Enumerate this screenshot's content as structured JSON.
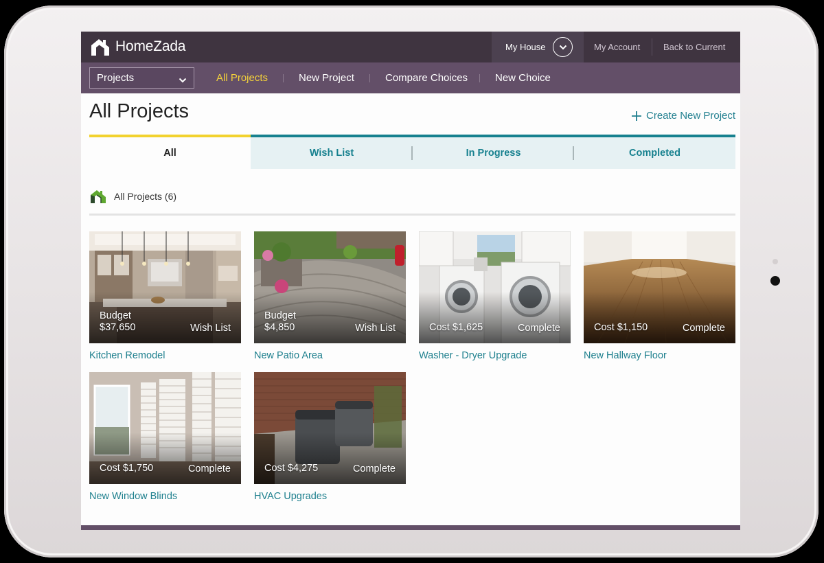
{
  "brand": {
    "name": "HomeZada"
  },
  "topbar": {
    "house_selector": "My House",
    "my_account": "My Account",
    "back_to_current": "Back to Current"
  },
  "subnav": {
    "select_value": "Projects",
    "items": [
      {
        "label": "All Projects",
        "active": true
      },
      {
        "label": "New Project",
        "active": false
      },
      {
        "label": "Compare Choices",
        "active": false
      },
      {
        "label": "New Choice",
        "active": false
      }
    ]
  },
  "page": {
    "title": "All Projects",
    "create_link": "Create New Project"
  },
  "tabs": [
    {
      "label": "All",
      "active": true
    },
    {
      "label": "Wish List",
      "active": false
    },
    {
      "label": "In Progress",
      "active": false
    },
    {
      "label": "Completed",
      "active": false
    }
  ],
  "section": {
    "label": "All Projects (6)"
  },
  "projects": [
    {
      "name": "Kitchen Remodel",
      "amount_label": "Budget",
      "amount": "$37,650",
      "status": "Wish List"
    },
    {
      "name": "New Patio Area",
      "amount_label": "Budget",
      "amount": "$4,850",
      "status": "Wish List"
    },
    {
      "name": "Washer - Dryer Upgrade",
      "amount_text": "Cost $1,625",
      "status": "Complete"
    },
    {
      "name": "New Hallway Floor",
      "amount_text": "Cost $1,150",
      "status": "Complete"
    },
    {
      "name": "New Window Blinds",
      "amount_text": "Cost $1,750",
      "status": "Complete"
    },
    {
      "name": "HVAC Upgrades",
      "amount_text": "Cost $4,275",
      "status": "Complete"
    }
  ],
  "colors": {
    "topbar": "#3f3440",
    "subnav": "#634f68",
    "active_nav": "#f4d23a",
    "teal": "#17818f",
    "brand_green": "#5fa830"
  }
}
